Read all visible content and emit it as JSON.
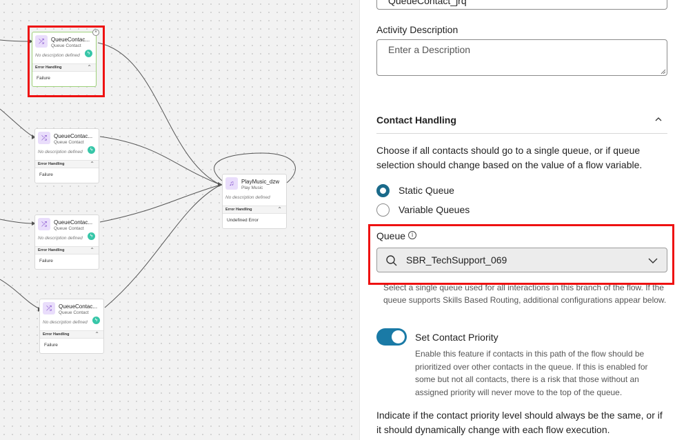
{
  "canvas": {
    "nodes": [
      {
        "title": "QueueContac...",
        "subtitle": "Queue Contact",
        "desc": "No description defined",
        "error_handling": "Error Handling",
        "failure": "Failure"
      },
      {
        "title": "QueueContac...",
        "subtitle": "Queue Contact",
        "desc": "No description defined",
        "error_handling": "Error Handling",
        "failure": "Failure"
      },
      {
        "title": "QueueContac...",
        "subtitle": "Queue Contact",
        "desc": "No description defined",
        "error_handling": "Error Handling",
        "failure": "Failure"
      },
      {
        "title": "QueueContac...",
        "subtitle": "Queue Contact",
        "desc": "No description defined",
        "error_handling": "Error Handling",
        "failure": "Failure"
      },
      {
        "title": "PlayMusic_dzw",
        "subtitle": "Play Music",
        "desc": "No description defined",
        "error_handling": "Error Handling",
        "failure": "Undefined Error"
      }
    ],
    "icons": {
      "queue": "shuffle-icon",
      "music": "music-note-icon",
      "event": "bolt-icon",
      "close": "close-icon"
    }
  },
  "panel": {
    "activity_name_value": "QueueContact_jrq",
    "activity_description_label": "Activity Description",
    "activity_description_placeholder": "Enter a Description",
    "contact_handling_title": "Contact Handling",
    "contact_handling_text": "Choose if all contacts should go to a single queue, or if queue selection should change based on the value of a flow variable.",
    "radio_static": "Static Queue",
    "radio_variable": "Variable Queues",
    "queue_label": "Queue",
    "queue_value": "SBR_TechSupport_069",
    "queue_help": "Select a single queue used for all interactions in this branch of the flow. If the queue supports Skills Based Routing, additional configurations appear below.",
    "priority_label": "Set Contact Priority",
    "priority_help": "Enable this feature if contacts in this path of the flow should be prioritized over other contacts in the queue. If this is enabled for some but not all contacts, there is a risk that those without an assigned priority will never move to the top of the queue.",
    "priority_level_text": "Indicate if the contact priority level should always be the same, or if it should dynamically change with each flow execution."
  },
  "colors": {
    "accent": "#1a7aa6",
    "highlight": "#ee1111",
    "node_icon_bg": "#e9ddfb",
    "event_green": "#37c6a8"
  }
}
